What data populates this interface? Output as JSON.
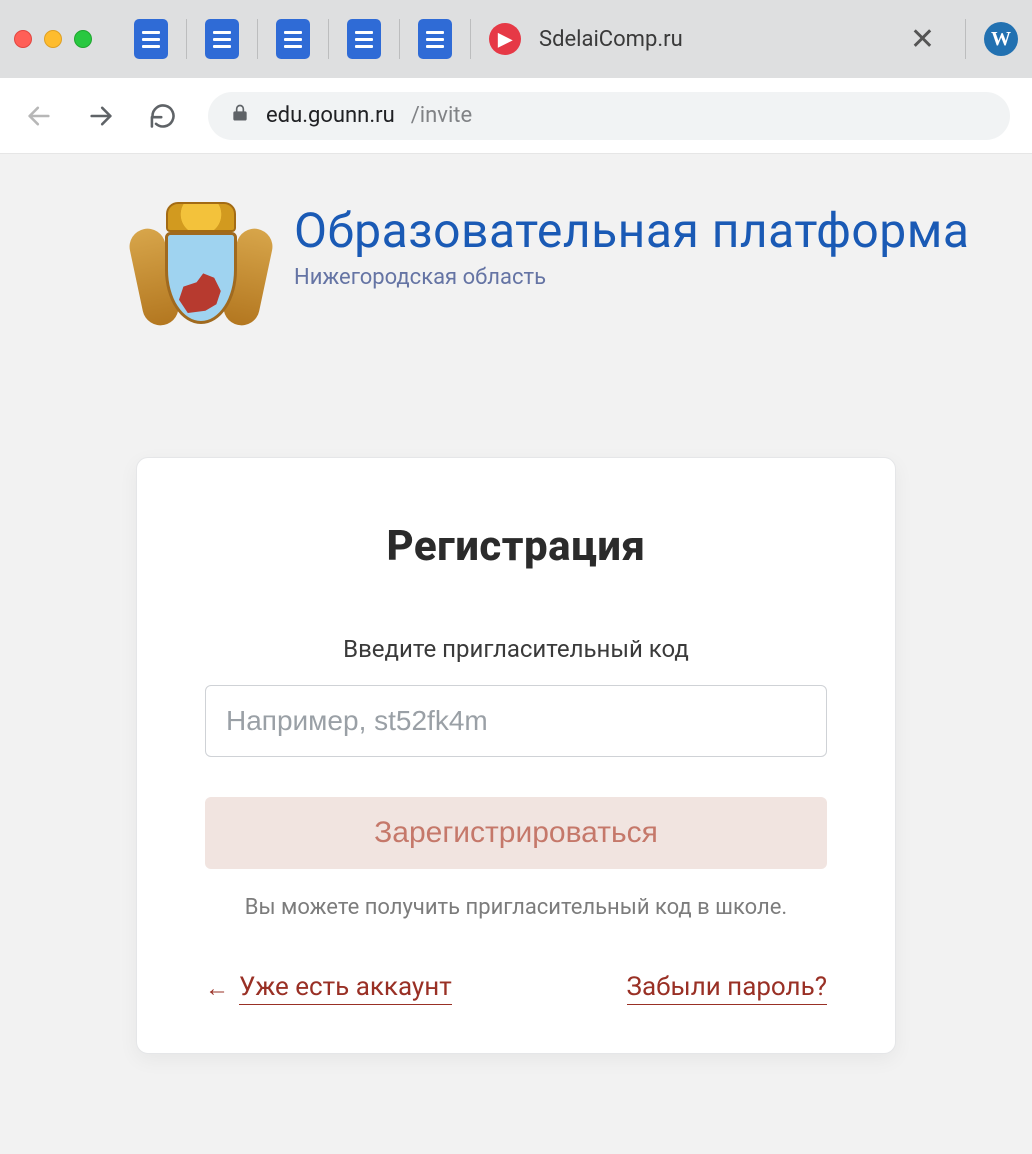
{
  "browser": {
    "tab_title": "SdelaiComp.ru",
    "url_host": "edu.gounn.ru",
    "url_path": "/invite"
  },
  "brand": {
    "title": "Образовательная платформа",
    "subtitle": "Нижегородская область"
  },
  "card": {
    "heading": "Регистрация",
    "prompt": "Введите пригласительный код",
    "input_placeholder": "Например, st52fk4m",
    "register_label": "Зарегистрироваться",
    "hint": "Вы можете получить пригласительный код в школе.",
    "have_account_label": "Уже есть аккаунт",
    "forgot_password_label": "Забыли пароль?"
  }
}
